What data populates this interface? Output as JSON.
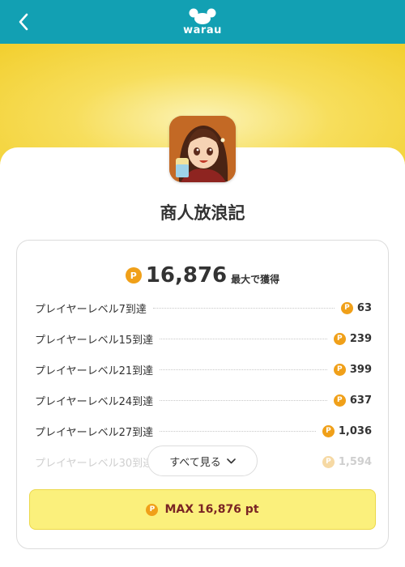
{
  "header": {
    "logo_text": "warau"
  },
  "app": {
    "title": "商人放浪記"
  },
  "reward": {
    "total": "16,876",
    "total_suffix": "最大で獲得",
    "coin_symbol": "P",
    "rows": [
      {
        "label": "プレイヤーレベル7到達",
        "points": "63"
      },
      {
        "label": "プレイヤーレベル15到達",
        "points": "239"
      },
      {
        "label": "プレイヤーレベル21到達",
        "points": "399"
      },
      {
        "label": "プレイヤーレベル24到達",
        "points": "637"
      },
      {
        "label": "プレイヤーレベル27到達",
        "points": "1,036"
      },
      {
        "label": "プレイヤーレベル30到達",
        "points": "1,594"
      }
    ],
    "show_all_label": "すべて見る",
    "max_button_label": "MAX 16,876 pt"
  },
  "colors": {
    "header_bg": "#12a0b3",
    "hero_yellow": "#f2cf2e",
    "coin": "#f0a019",
    "max_button_bg": "#fbf07c",
    "max_button_text": "#7a2424"
  }
}
